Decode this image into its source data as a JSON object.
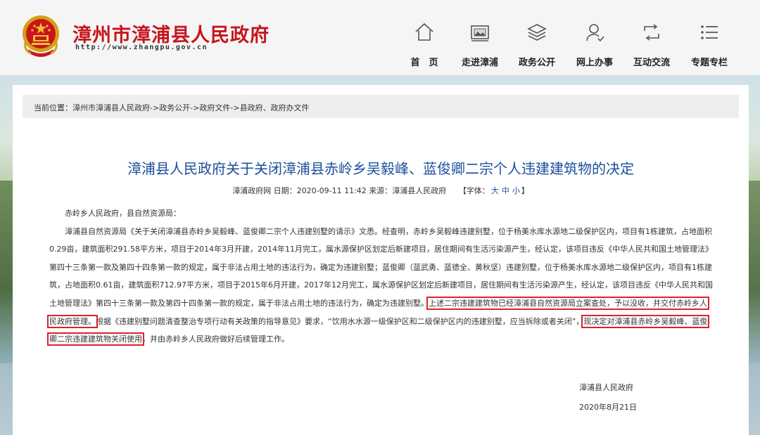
{
  "site": {
    "title": "漳州市漳浦县人民政府",
    "url": "http://www.zhangpu.gov.cn"
  },
  "nav": [
    {
      "label": "首　页",
      "icon": "home-icon"
    },
    {
      "label": "走进漳浦",
      "icon": "image-icon"
    },
    {
      "label": "政务公开",
      "icon": "layers-icon"
    },
    {
      "label": "网上办事",
      "icon": "user-icon"
    },
    {
      "label": "互动交流",
      "icon": "exchange-icon"
    },
    {
      "label": "专题专栏",
      "icon": "list-icon"
    }
  ],
  "breadcrumb": {
    "prefix": "当前位置：",
    "items": [
      "漳州市漳浦县人民政府",
      "政务公开",
      "政府文件",
      "县政府、政府办文件"
    ],
    "sep": "->"
  },
  "article": {
    "title": "漳浦县人民政府关于关闭漳浦县赤岭乡吴毅峰、蓝俊卿二宗个人违建建筑物的决定",
    "meta_source_prefix": "漳浦政府网 日期：2020-09-11 11:42  来源：漳浦县人民政府",
    "font_label_open": "【字体：",
    "font_large": "大",
    "font_medium": "中",
    "font_small": "小",
    "font_label_close": "】",
    "salutation": "赤岭乡人民政府，县自然资源局：",
    "para1_a": "漳浦县自然资源局《关于关闭漳浦县赤岭乡吴毅峰、蓝俊卿二宗个人违建别墅的请示》文悉。经查明，赤岭乡吴毅峰违建别墅，位于杨美水库水源地二级保护区内，项目有1栋建筑，占地面积0.29亩，建筑面积291.58平方米，项目于2014年3月开建，2014年11月完工，属水源保护区划定后新建项目，居住期间有生活污染源产生，经认定，该项目违反《中华人民共和国土地管理法》第四十三条第一款及第四十四条第一款的规定，属于非法占用土地的违法行为，确定为违建别墅；蓝俊卿（蓝武勇、蓝德全、黄秋坚）违建别墅，位于杨美水库水源地二级保护区内，项目有1栋建筑，占地面积0.61亩，建筑面积712.97平方米，项目于2015年6月开建，2017年12月完工，属水源保护区划定后新建项目，居住期间有生活污染源产生，经认定，该项目违反《中华人民共和国土地管理法》第四十三条第一款及第四十四条第一款的规定，属于非法占用土地的违法行为，确定为违建别墅。",
    "highlight1": "上述二宗违建建筑物已经漳浦县自然资源局立案查处，予以没收，并交付赤岭乡人民政府管理。",
    "para1_b": "根据《违建别墅问题清查整治专项行动有关政策的指导意见》要求，“饮用水水源一级保护区和二级保护区内的违建别墅，应当拆除或者关闭”，",
    "highlight2": "现决定对漳浦县赤岭乡吴毅峰、蓝俊卿二宗违建建筑物关闭使用",
    "para1_c": "，并由赤岭乡人民政府做好后续管理工作。",
    "signer": "漳浦县人民政府",
    "date": "2020年8月21日"
  },
  "colors": {
    "brand_red": "#c5161d",
    "title_blue": "#1b4f9c",
    "highlight_border": "#d9232d"
  }
}
